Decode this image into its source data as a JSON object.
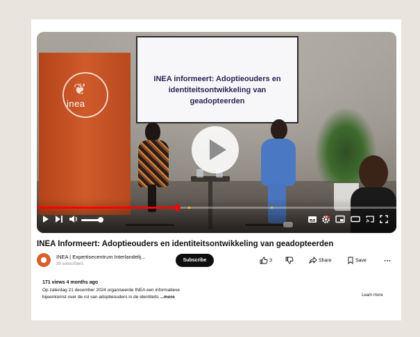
{
  "player": {
    "slide_text": "INEA informeert: Adoptieouders en identiteitsontwikkeling van geadopteerden",
    "banner_logo_text": "inea",
    "banner_sub_text": "",
    "progress": 0.39,
    "chapter_markers": [
      0.42,
      0.65
    ],
    "volume": 0.8
  },
  "video": {
    "title": "INEA Informeert: Adoptieouders en identiteitsontwikkeling van geadopteerden"
  },
  "channel": {
    "name": "INEA | Expertisecentrum Interlandelij...",
    "subscribers": "39 subscribers",
    "subscribe_label": "Subscribe"
  },
  "actions": {
    "like_count": "3",
    "share_label": "Share",
    "save_label": "Save"
  },
  "description": {
    "stats": "171 views  4 months ago",
    "line1": "Op zaterdag 21 december 2024 organiseerde INEA een informatieve",
    "line2": "bijeenkomst over de rol van adoptieouders in de identiteits",
    "more_label": "...more",
    "learn_more": "Learn more"
  },
  "colors": {
    "progress": "#ff0000",
    "chapter": "#f5c400",
    "page_bg": "#e9e5de"
  }
}
